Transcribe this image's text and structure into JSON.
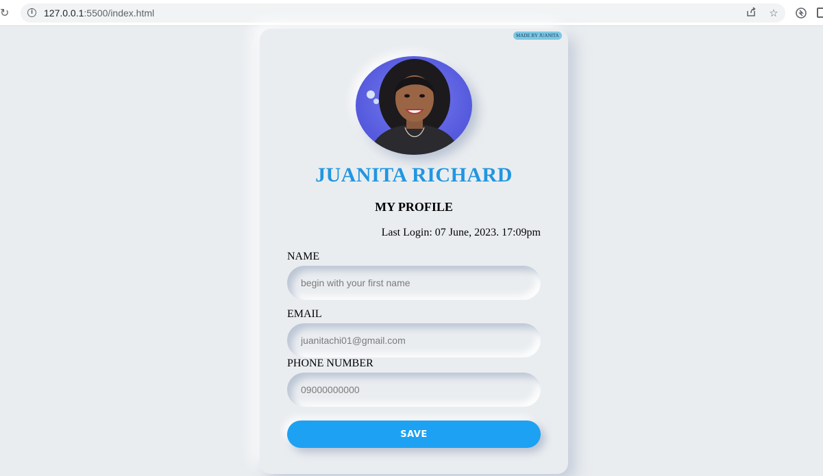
{
  "browser": {
    "url_host": "127.0.0.1",
    "url_path": ":5500/index.html",
    "icons": [
      "reload-icon",
      "info-icon",
      "share-icon",
      "star-icon",
      "extension-icon",
      "sidepanel-icon"
    ]
  },
  "card": {
    "badge": "MADE BY JUANITA",
    "name": "JUANITA RICHARD",
    "section_title": "MY PROFILE",
    "last_login": "Last Login: 07 June, 2023. 17:09pm",
    "fields": {
      "name": {
        "label": "NAME",
        "placeholder": "begin with your first name",
        "value": ""
      },
      "email": {
        "label": "EMAIL",
        "placeholder": "juanitachi01@gmail.com",
        "value": ""
      },
      "phone": {
        "label": "PHONE NUMBER",
        "placeholder": "09000000000",
        "value": ""
      }
    },
    "save_label": "SAVE"
  },
  "colors": {
    "accent": "#1da1f2",
    "name_color": "#2196e0",
    "background": "#eaedf0",
    "badge": "#7cc7e6",
    "avatar_backdrop": "#5a5fe0"
  }
}
